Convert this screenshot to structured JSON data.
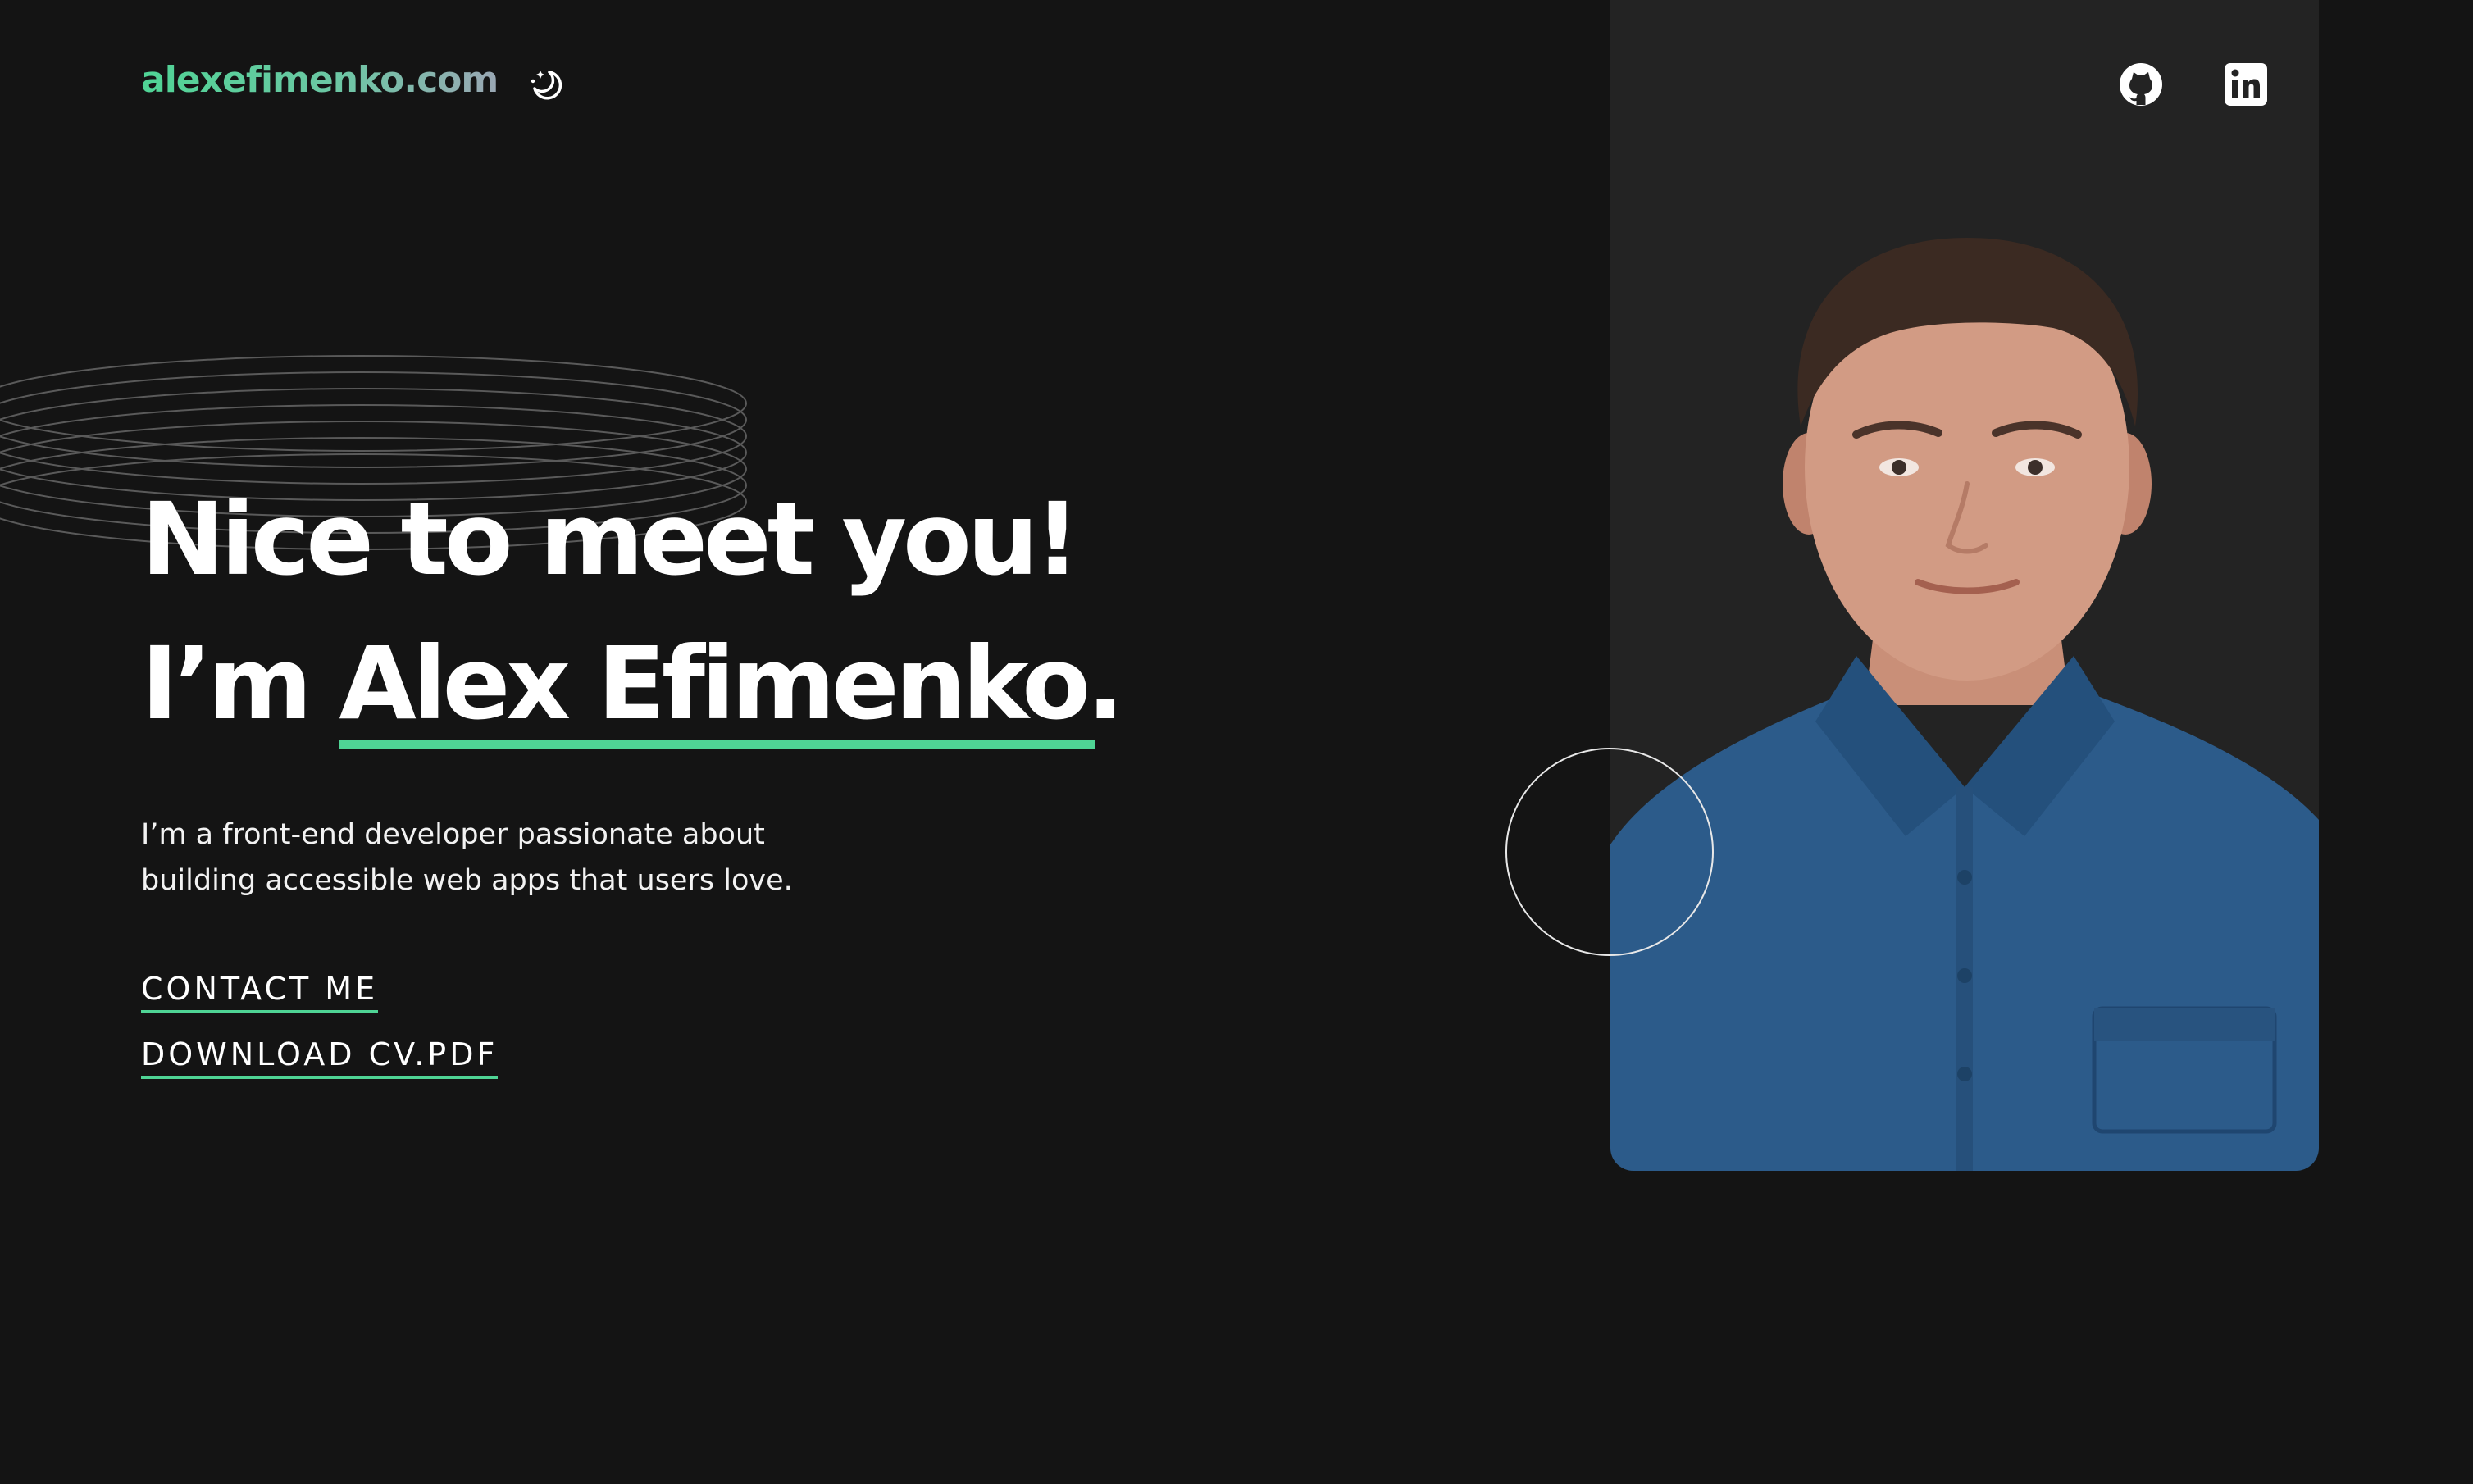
{
  "header": {
    "logo_text": "alexefimenko.com",
    "theme_toggle_icon": "moon-stars-icon"
  },
  "hero": {
    "headline_line1": "Nice to meet you!",
    "headline_prefix": "I’m ",
    "headline_name": "Alex Efimenko.",
    "intro": "I’m a front-end developer passionate about building accessible web apps that users love.",
    "contact_label": "CONTACT ME",
    "cv_label": "DOWNLOAD CV.PDF"
  },
  "social": {
    "github_icon": "github-icon",
    "linkedin_icon": "linkedin-icon"
  },
  "colors": {
    "background": "#141414",
    "card": "#232323",
    "accent": "#4fd495",
    "shirt": "#2c5b8a"
  }
}
